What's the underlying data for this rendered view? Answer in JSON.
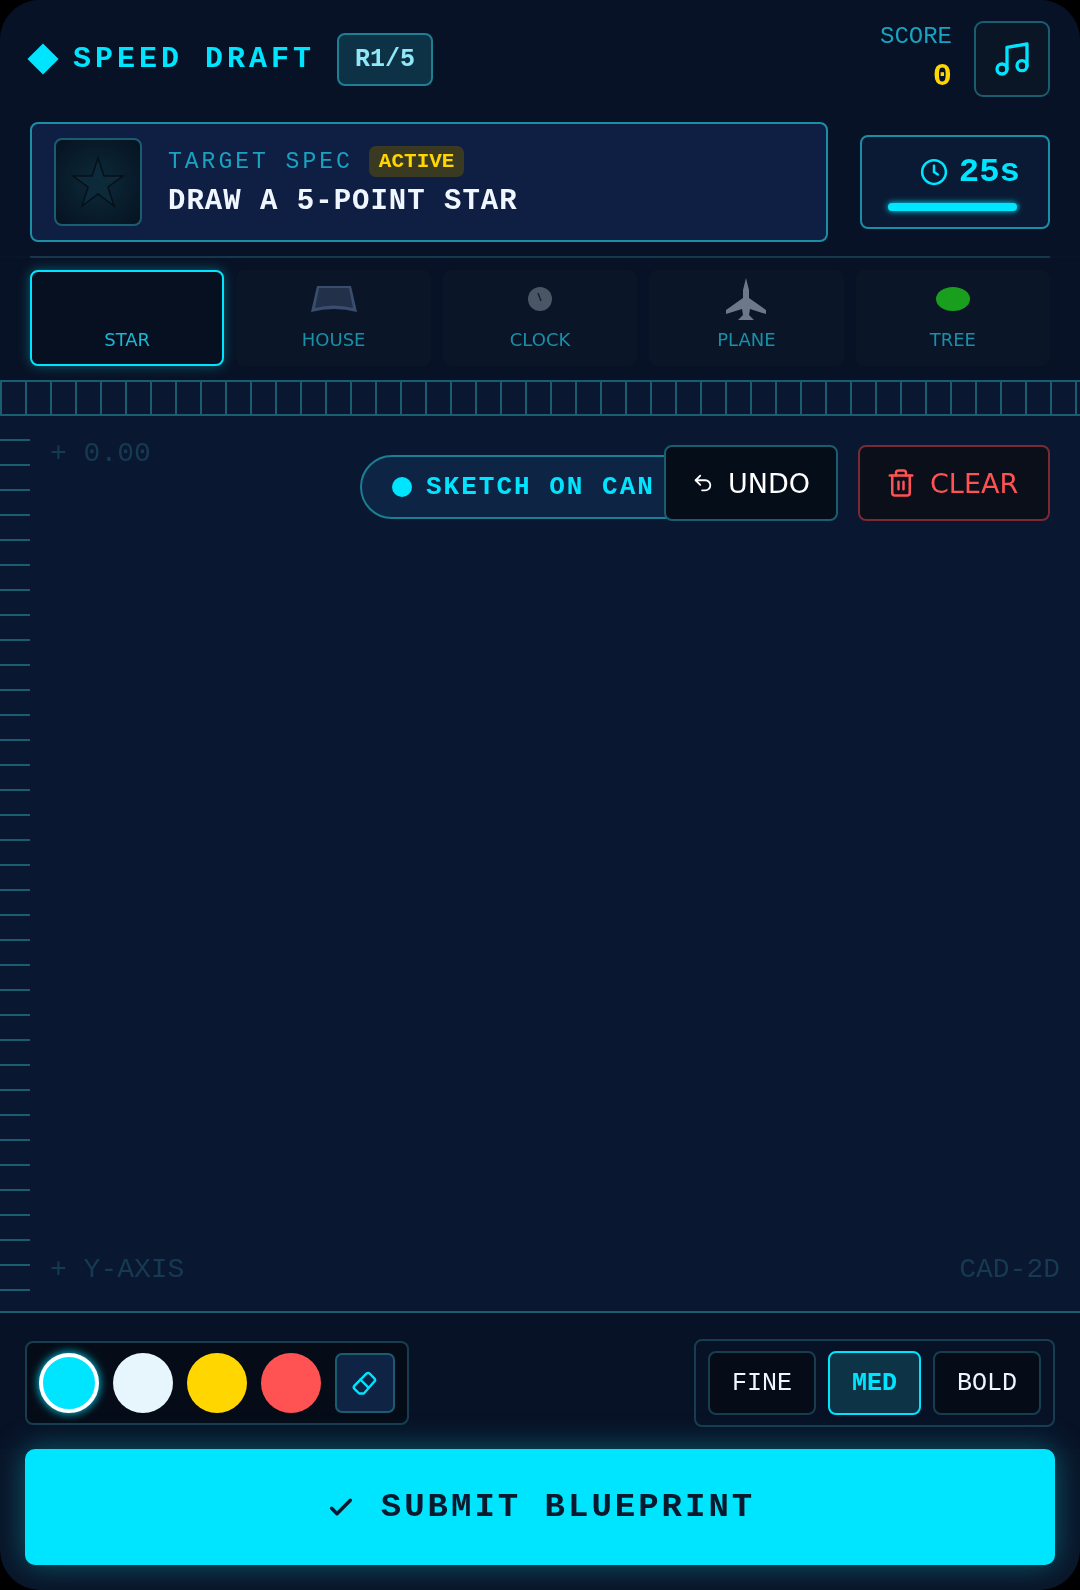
{
  "header": {
    "title": "SPEED DRAFT",
    "round": "R1/5",
    "score_label": "SCORE",
    "score": "0"
  },
  "target": {
    "label": "TARGET SPEC",
    "status": "ACTIVE",
    "instruction": "DRAW A 5-POINT STAR"
  },
  "timer": {
    "value": "25s",
    "level": 0.98
  },
  "shapes": [
    {
      "label": "STAR",
      "kind": "star",
      "selected": true
    },
    {
      "label": "HOUSE",
      "kind": "house",
      "selected": false
    },
    {
      "label": "CLOCK",
      "kind": "clock",
      "selected": false
    },
    {
      "label": "PLANE",
      "kind": "plane",
      "selected": false
    },
    {
      "label": "TREE",
      "kind": "tree",
      "selected": false
    }
  ],
  "canvas": {
    "origin_label": "+ 0.00",
    "hint": "SKETCH ON CAN",
    "y_axis_label": "+ Y-AXIS",
    "mode_label": "CAD-2D"
  },
  "actions": [
    "UNDO",
    "CLEAR"
  ],
  "colors": [
    {
      "color": "#00e5ff",
      "selected": true
    },
    {
      "color": "#e6f6fc",
      "selected": false
    },
    {
      "color": "#ffd600",
      "selected": false
    },
    {
      "color": "#ff5252",
      "selected": false
    }
  ],
  "eraser": {
    "selected": false
  },
  "thickness": [
    {
      "label": "FINE",
      "selected": false
    },
    {
      "label": "MED",
      "selected": true
    },
    {
      "label": "BOLD",
      "selected": false
    }
  ],
  "submit": "SUBMIT BLUEPRINT"
}
